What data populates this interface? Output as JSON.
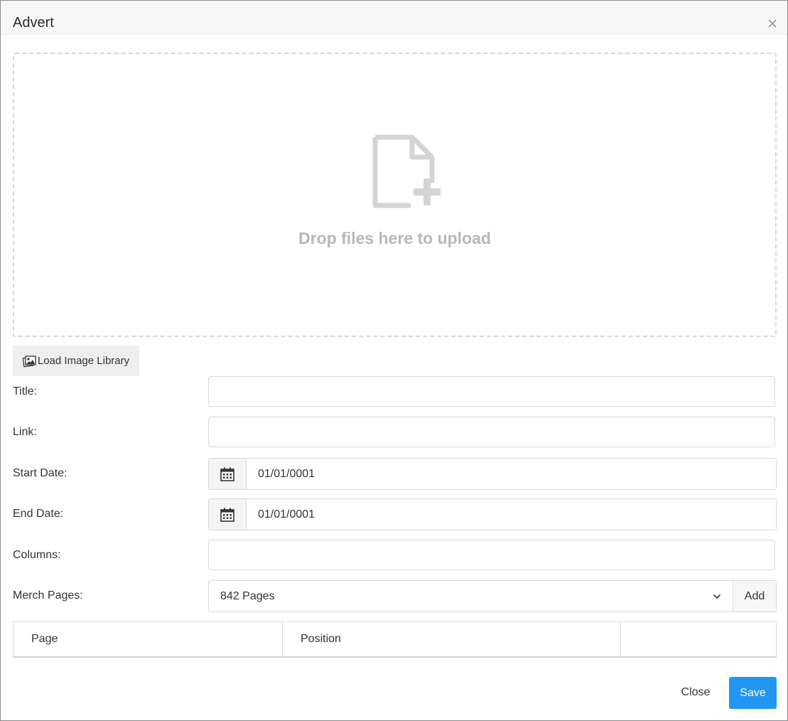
{
  "modal": {
    "title": "Advert",
    "close_icon": "close-icon"
  },
  "dropzone": {
    "icon": "file-add-icon",
    "text": "Drop files here to upload"
  },
  "image_library": {
    "icon": "image-library-icon",
    "label": "Load Image Library"
  },
  "form": {
    "title_label": "Title:",
    "title_value": "",
    "link_label": "Link:",
    "link_value": "",
    "start_date_label": "Start Date:",
    "start_date_value": "01/01/0001",
    "end_date_label": "End Date:",
    "end_date_value": "01/01/0001",
    "columns_label": "Columns:",
    "columns_value": "",
    "merch_pages_label": "Merch Pages:",
    "merch_pages_selected": "842 Pages",
    "add_label": "Add"
  },
  "table": {
    "columns": [
      "Page",
      "Position",
      ""
    ]
  },
  "footer": {
    "close_label": "Close",
    "save_label": "Save"
  },
  "colors": {
    "primary": "#2196f3",
    "header_bg": "#f7f7f7",
    "dropzone_border": "#d6d6d6"
  }
}
